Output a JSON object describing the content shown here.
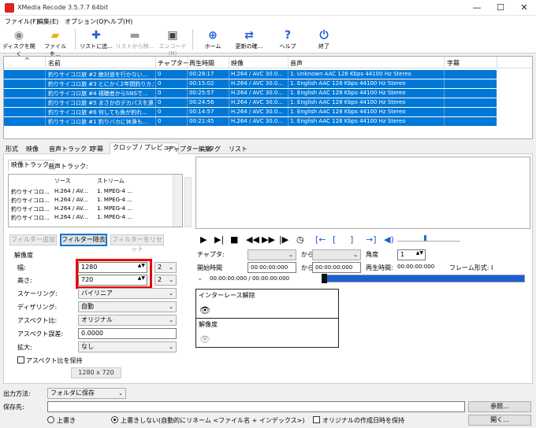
{
  "window": {
    "title": "XMedia Recode 3.5.7.7 64bit"
  },
  "menu": [
    "ファイル(F)",
    "編集(E)",
    "オプション(O)",
    "ヘルプ(H)"
  ],
  "toolbar": {
    "open_disc": "ディスクを開く",
    "open_file": "ファイルを...",
    "add_list": "リストに追...",
    "remove_list": "リストから除...",
    "encode": "エンコード(N)",
    "home": "ホーム",
    "update": "更新の確...",
    "help": "ヘルプ",
    "exit": "終了"
  },
  "grid": {
    "headers": [
      "名前",
      "チャプター",
      "再生時間",
      "映像",
      "音声",
      "字幕"
    ],
    "rows": [
      [
        "釣りサイコロ旅 #2 絶対道を行かない...",
        "0",
        "00:28:17",
        "H.264 / AVC  30.0...",
        "1. Unknown AAC  128 Kbps 44100 Hz Stereo"
      ],
      [
        "釣りサイコロ旅 #3 とにかく2年間釣りカメ...",
        "0",
        "00:15:02",
        "H.264 / AVC  30.0...",
        "1. English AAC  128 Kbps 44100 Hz Stereo"
      ],
      [
        "釣りサイコロ旅 #4 視聴者からSNSで...",
        "0",
        "00:25:57",
        "H.264 / AVC  30.0...",
        "1. English AAC  128 Kbps 44100 Hz Stereo"
      ],
      [
        "釣りサイコロ旅 #5 まさかのデカバスを連...",
        "0",
        "00:24:56",
        "H.264 / AVC  30.0...",
        "1. English AAC  128 Kbps 44100 Hz Stereo"
      ],
      [
        "釣りサイコロ旅 #6 何しても魚が釣れ...",
        "0",
        "00:14:57",
        "H.264 / AVC  30.0...",
        "1. English AAC  128 Kbps 44100 Hz Stereo"
      ],
      [
        "釣りサイコロ旅 #1 釣りバカに休漁も...",
        "0",
        "00:21:45",
        "H.264 / AVC  30.0...",
        "1. English AAC  128 Kbps 44100 Hz Stereo"
      ]
    ]
  },
  "tabs": [
    "形式",
    "映像",
    "音声トラック 1",
    "字幕",
    "クロップ / プレビュー",
    "チャプター編集",
    "タグ",
    "リスト"
  ],
  "subtabs": [
    "映像トラック:",
    "音声トラック:"
  ],
  "tracklist": {
    "headers": [
      "ソース",
      "ストリーム"
    ],
    "rows": [
      [
        "釣りサイコロ...",
        "H.264 / AV...",
        "1. MPEG-4 ..."
      ],
      [
        "釣りサイコロ...",
        "H.264 / AV...",
        "1. MPEG-4 ..."
      ],
      [
        "釣りサイコロ...",
        "H.264 / AV...",
        "1. MPEG-4 ..."
      ],
      [
        "釣りサイコロ...",
        "H.264 / AV...",
        "1. MPEG-4 ..."
      ]
    ]
  },
  "filter_buttons": {
    "add": "フィルター追加",
    "remove": "フィルター除去",
    "reset": "フィルターをリセット"
  },
  "resolution": {
    "group": "解像度",
    "width_label": "幅:",
    "width_value": "1280",
    "width_mod": "2",
    "height_label": "高さ:",
    "height_value": "720",
    "height_mod": "2",
    "scaling_label": "スケーリング:",
    "scaling_value": "バイリニア",
    "dither_label": "ディザリング:",
    "dither_value": "自動",
    "aspect_label": "アスペクト比:",
    "aspect_value": "オリジナル",
    "aspect_err_label": "アスペクト誤差:",
    "aspect_err_value": "0.0000",
    "zoom_label": "拡大:",
    "zoom_value": "なし",
    "keep_aspect": "アスペクト比を保持",
    "size_display": "1280 x 720"
  },
  "preview": {
    "chapter_label": "チャプタ:",
    "from_label": "から",
    "angle_label": "角度",
    "angle_value": "1",
    "start_label": "開始時間",
    "start_value": "00:00:00:000",
    "from2_label": "から",
    "to_value": "00:00:00:000",
    "duration_label": "再生時間:",
    "duration_value": "00:00:00:000",
    "frame_label": "フレーム形式: I",
    "time_display": "00:00:00:000 / 00:00:00:000",
    "filter1": "インターレース解除",
    "filter2": "解像度"
  },
  "output": {
    "method_label": "出力方法:",
    "method_value": "フォルダに保存",
    "dest_label": "保存先:",
    "dest_value": "",
    "browse": "参照...",
    "overwrite": "上書き",
    "no_overwrite": "上書きしない(自動的にリネーム <ファイル名 + インデックス>)",
    "keep_date": "オリジナルの作成日時を保持",
    "open": "開く..."
  }
}
